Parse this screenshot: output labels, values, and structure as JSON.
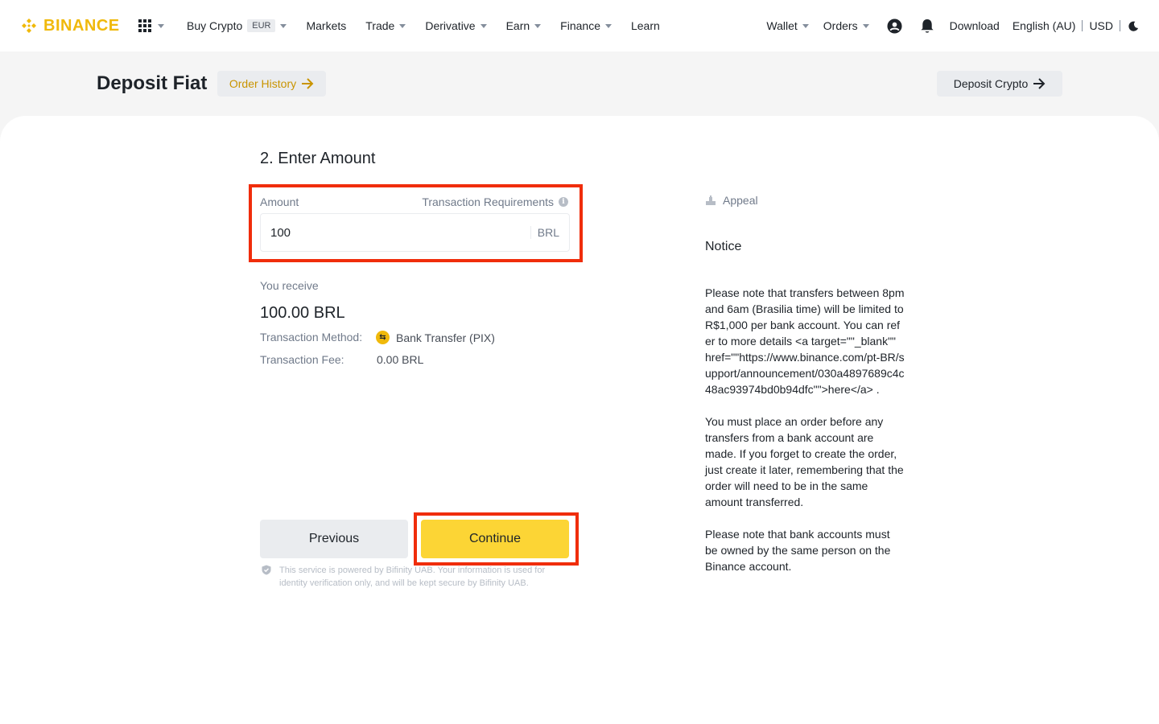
{
  "brand": {
    "name": "BINANCE",
    "color": "#f0b90b"
  },
  "nav": {
    "items": [
      {
        "label": "Buy Crypto",
        "badge": "EUR",
        "dropdown": true
      },
      {
        "label": "Markets",
        "dropdown": false
      },
      {
        "label": "Trade",
        "dropdown": true
      },
      {
        "label": "Derivative",
        "dropdown": true
      },
      {
        "label": "Earn",
        "dropdown": true
      },
      {
        "label": "Finance",
        "dropdown": true
      },
      {
        "label": "Learn",
        "dropdown": false
      }
    ],
    "right": {
      "wallet": "Wallet",
      "orders": "Orders",
      "download": "Download",
      "language": "English (AU)",
      "currency": "USD"
    }
  },
  "header": {
    "title": "Deposit Fiat",
    "order_history": "Order History",
    "deposit_crypto": "Deposit Crypto"
  },
  "form": {
    "step_title": "2. Enter Amount",
    "amount_label": "Amount",
    "requirements_label": "Transaction Requirements",
    "amount_value": "100",
    "amount_currency": "BRL",
    "receive_label": "You receive",
    "receive_value": "100.00 BRL",
    "method_label": "Transaction Method:",
    "method_value": "Bank Transfer (PIX)",
    "fee_label": "Transaction Fee:",
    "fee_value": "0.00 BRL",
    "previous": "Previous",
    "continue": "Continue",
    "powered_text": "This service is powered by Bifinity UAB. Your information is used for identity verification only, and will be kept secure by Bifinity UAB."
  },
  "side": {
    "appeal": "Appeal",
    "notice_title": "Notice",
    "notice_paragraphs": [
      "Please note that transfers between 8pm and 6am (Brasilia time) will be limited to R$1,000 per bank account. You can refer to more details <a target=\"\"_blank\"\" href=\"\"https://www.binance.com/pt-BR/support/announcement/030a4897689c4c48ac93974bd0b94dfc\"\">here</a> .",
      "You must place an order before any transfers from a bank account are made. If you forget to create the order, just create it later, remembering that the order will need to be in the same amount transferred.",
      "Please note that bank accounts must be owned by the same person on the Binance account."
    ]
  },
  "colors": {
    "accent": "#fcd535",
    "highlight": "#f02d0b"
  }
}
